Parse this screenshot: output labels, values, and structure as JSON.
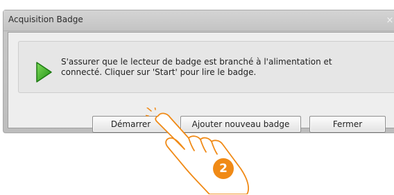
{
  "window": {
    "title": "Acquisition Badge",
    "close_glyph": "×"
  },
  "message": {
    "icon": "play-icon",
    "text": "S'assurer que le lecteur de badge est branché à l'alimentation et\nconnecté. Cliquer sur 'Start' pour lire le badge."
  },
  "buttons": {
    "start": "Démarrer",
    "add_badge": "Ajouter nouveau badge",
    "close": "Fermer"
  },
  "callout": {
    "step": "2",
    "color": "#f08a16",
    "icon": "pointing-hand-icon"
  },
  "colors": {
    "play_icon": "#2eae1e"
  }
}
